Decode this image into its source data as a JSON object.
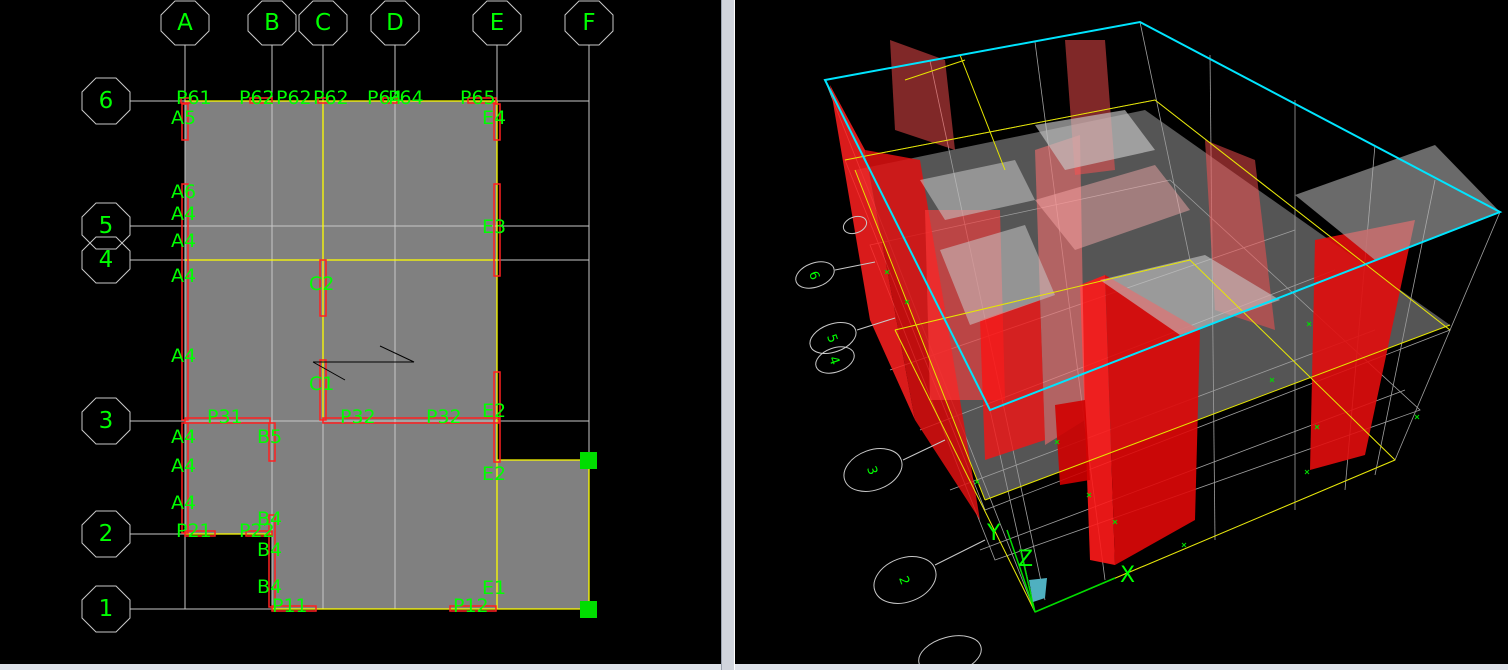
{
  "plan_view": {
    "grid_x": [
      "A",
      "B",
      "C",
      "D",
      "E",
      "F"
    ],
    "grid_y": [
      "6",
      "5",
      "4",
      "3",
      "2",
      "1"
    ],
    "labels": {
      "p61": "P61",
      "p62a": "P62",
      "p62b": "P62",
      "p62c": "P62",
      "p64a": "P64",
      "p64b": "P64",
      "p65": "P65",
      "a5": "A5",
      "e4": "E4",
      "a6": "A6",
      "a4_1": "A4",
      "a4_2": "A4",
      "e3": "E3",
      "a4_3": "A4",
      "c2": "C2",
      "a4_4": "A4",
      "c1": "C1",
      "p31": "P31",
      "p32a": "P32",
      "p32b": "P32",
      "e2a": "E2",
      "a4_5": "A4",
      "b5": "B5",
      "a4_6": "A4",
      "e2b": "E2",
      "a4_7": "A4",
      "b4a": "B4",
      "p21": "P21",
      "p22": "P22",
      "b4b": "B4",
      "b4c": "B4",
      "e1": "E1",
      "p11": "P11",
      "p12": "P12"
    }
  },
  "view_3d": {
    "axis_x": "X",
    "axis_y": "Y",
    "axis_z": "Z",
    "bubbles": [
      "6",
      "5",
      "4",
      "3",
      "2"
    ]
  },
  "colors": {
    "background": "#000000",
    "label": "#00ff00",
    "slab": "#808080",
    "wall": "#ff0000",
    "roof_outline": "#00e5ff",
    "beam": "#ffff00"
  }
}
